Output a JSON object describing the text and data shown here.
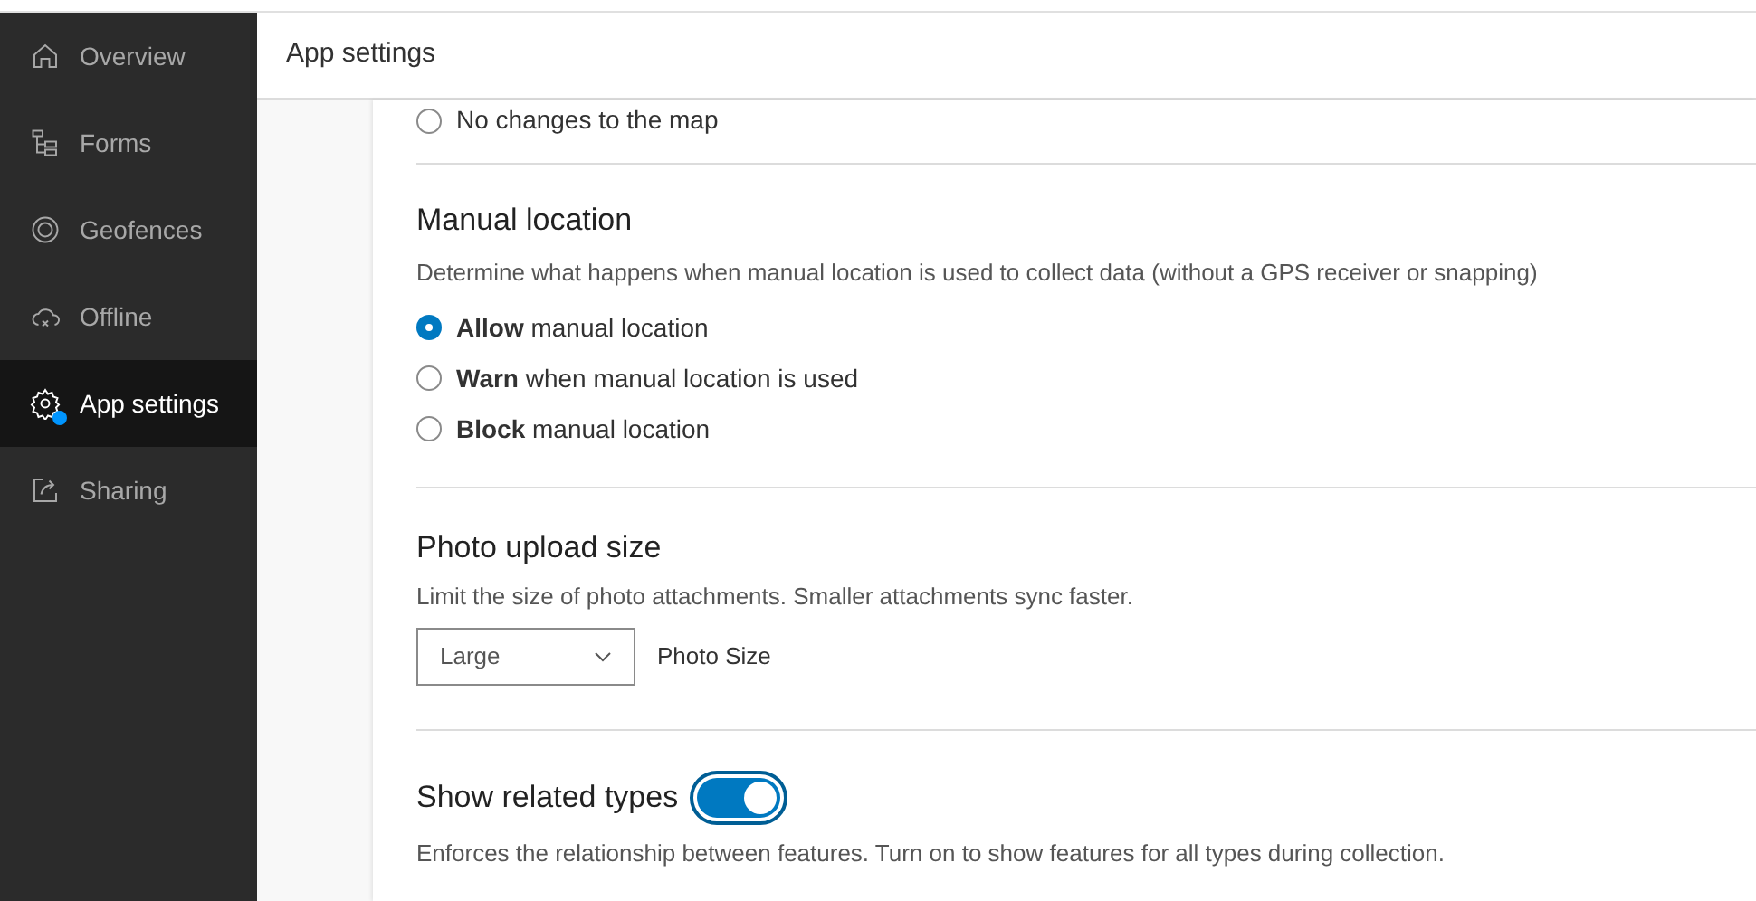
{
  "sidebar": {
    "items": [
      {
        "label": "Overview",
        "selected": false,
        "badge": false
      },
      {
        "label": "Forms",
        "selected": false,
        "badge": false
      },
      {
        "label": "Geofences",
        "selected": false,
        "badge": false
      },
      {
        "label": "Offline",
        "selected": false,
        "badge": false
      },
      {
        "label": "App settings",
        "selected": true,
        "badge": true
      },
      {
        "label": "Sharing",
        "selected": false,
        "badge": false
      }
    ]
  },
  "header": {
    "title": "App settings"
  },
  "previous_option": {
    "label": "No changes to the map",
    "selected": false
  },
  "manual_location": {
    "title": "Manual location",
    "description": "Determine what happens when manual location is used to collect data (without a GPS receiver or snapping)",
    "options": [
      {
        "label": "**Allow** manual location",
        "selected": true
      },
      {
        "label": "**Warn** when manual location is used",
        "selected": false
      },
      {
        "label": "**Block** manual location",
        "selected": false
      }
    ]
  },
  "photo_upload": {
    "title": "Photo upload size",
    "description": "Limit the size of photo attachments. Smaller attachments sync faster.",
    "select_value": "Large",
    "select_label": "Photo Size"
  },
  "related_types": {
    "title": "Show related types",
    "on": true,
    "description": "Enforces the relationship between features. Turn on to show features for all types during collection."
  }
}
